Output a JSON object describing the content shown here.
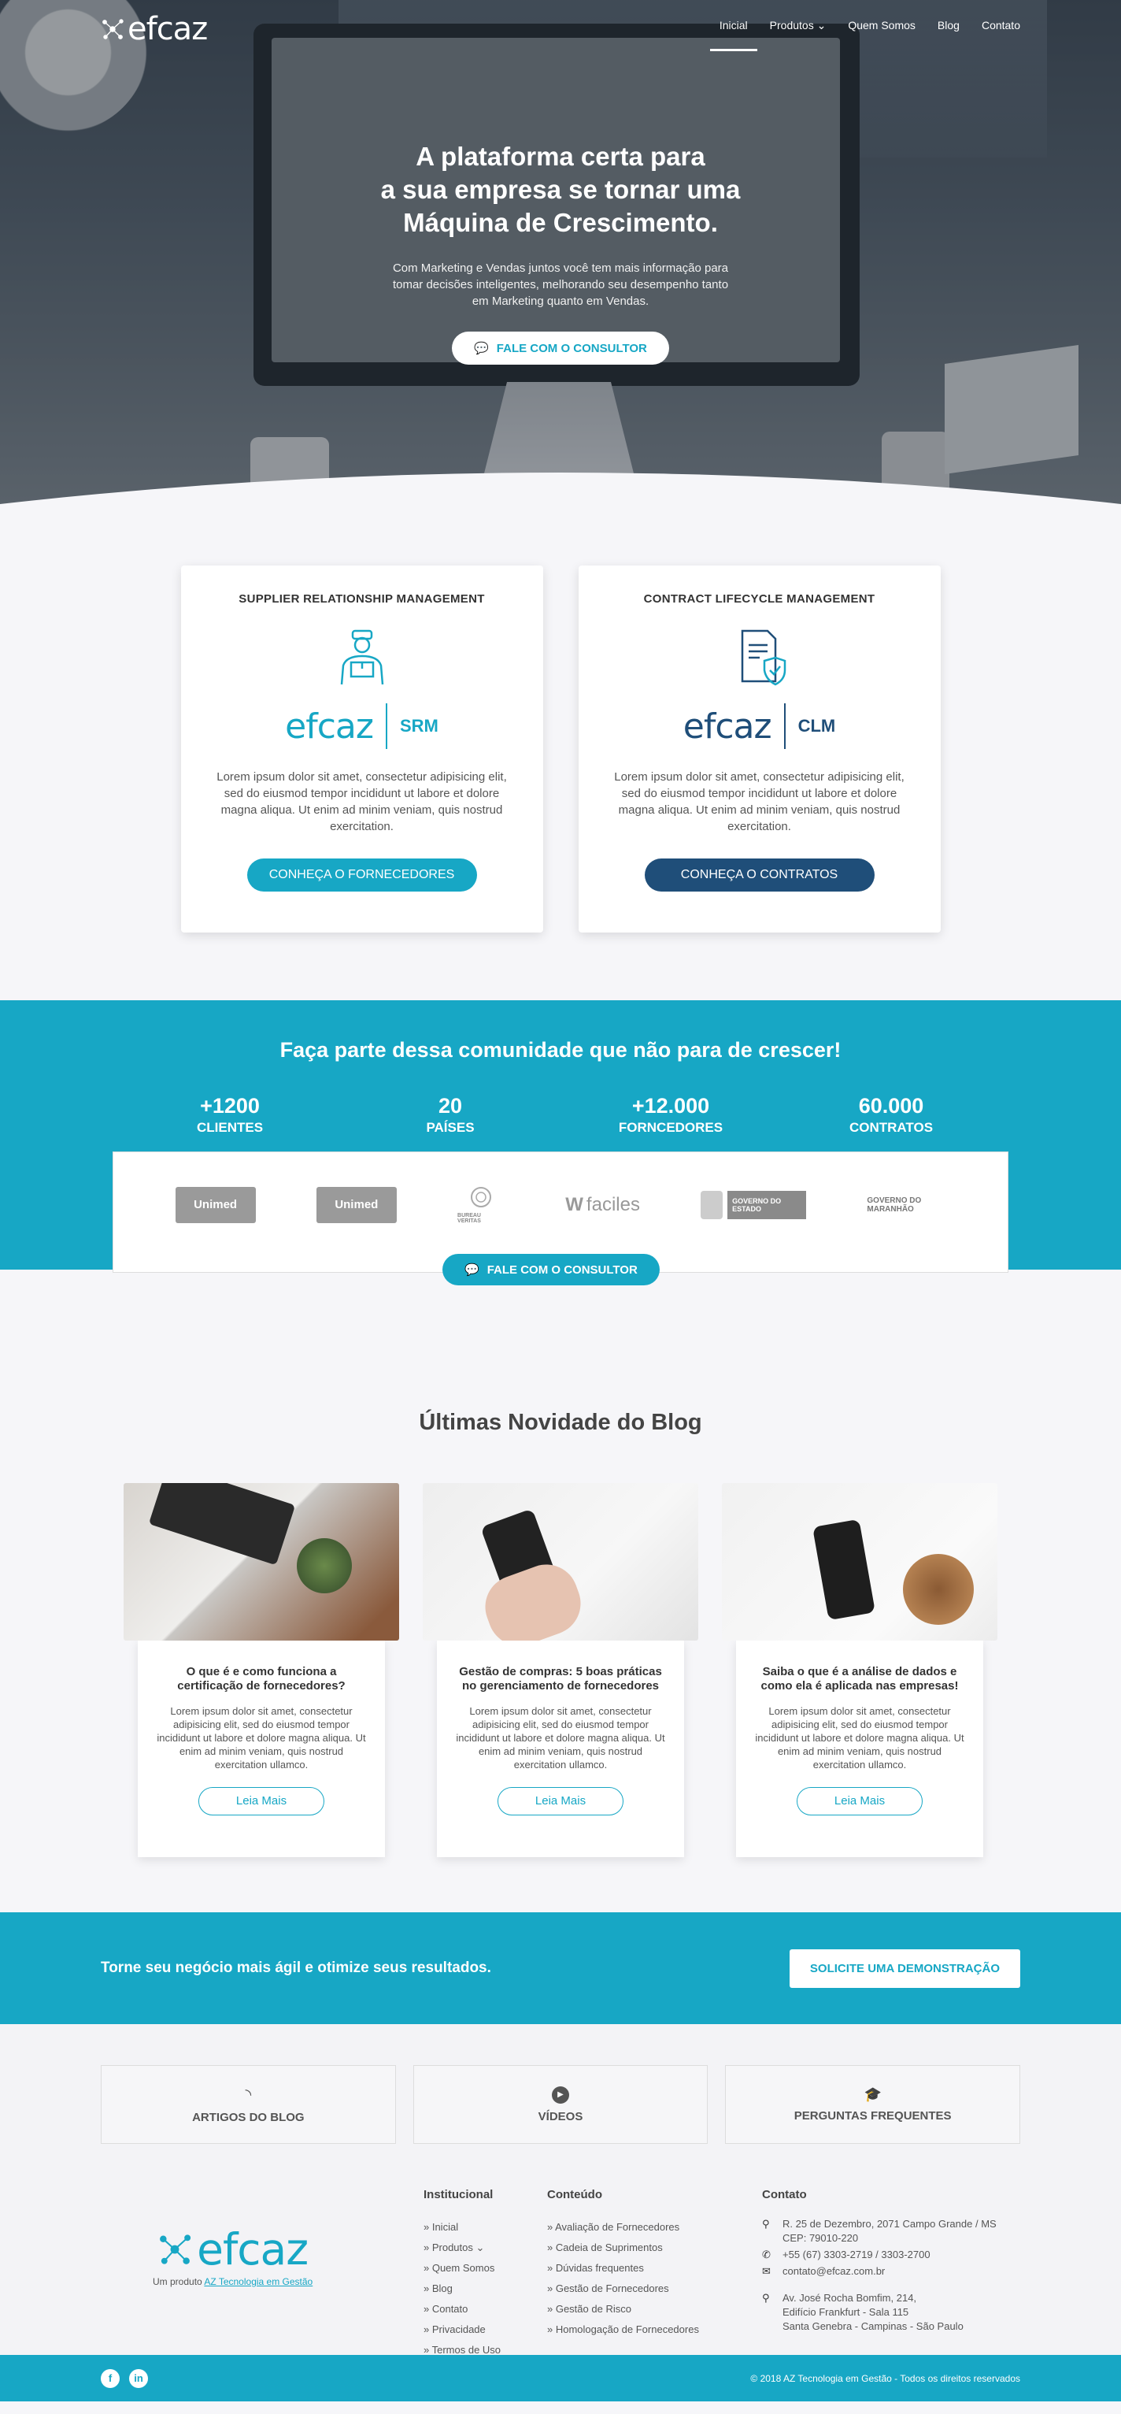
{
  "brand": {
    "name": "efcaz",
    "accent": "#17a7c5",
    "dark_accent": "#1f4e79"
  },
  "nav": {
    "items": [
      "Inicial",
      "Produtos",
      "Quem Somos",
      "Blog",
      "Contato"
    ],
    "active": "Inicial"
  },
  "hero": {
    "title_line1": "A plataforma certa para",
    "title_line2": "a sua empresa se tornar uma",
    "title_line3": "Máquina de Crescimento.",
    "text_line1": "Com Marketing e Vendas juntos você tem mais informação para",
    "text_line2": "tomar decisões inteligentes, melhorando seu desempenho tanto",
    "text_line3": "em Marketing quanto em Vendas.",
    "button": "FALE COM O CONSULTOR"
  },
  "products": [
    {
      "title": "SUPPLIER RELATIONSHIP MANAGEMENT",
      "logo": "efcaz",
      "code": "SRM",
      "text": "Lorem ipsum dolor sit amet, consectetur adipisicing elit, sed do eiusmod tempor incididunt ut labore et dolore magna aliqua. Ut enim ad minim veniam, quis nostrud exercitation.",
      "button": "CONHEÇA O FORNECEDORES",
      "color": "#17a7c5"
    },
    {
      "title": "CONTRACT LIFECYCLE MANAGEMENT",
      "logo": "efcaz",
      "code": "CLM",
      "text": "Lorem ipsum dolor sit amet, consectetur adipisicing elit, sed do eiusmod tempor incididunt ut labore et dolore magna aliqua. Ut enim ad minim veniam, quis nostrud exercitation.",
      "button": "CONHEÇA O CONTRATOS",
      "color": "#1f4e79"
    }
  ],
  "community": {
    "title": "Faça parte dessa comunidade que não para de crescer!",
    "stats": [
      {
        "num": "+1200",
        "label": "CLIENTES"
      },
      {
        "num": "20",
        "label": "PAÍSES"
      },
      {
        "num": "+12.000",
        "label": "FORNCEDORES"
      },
      {
        "num": "60.000",
        "label": "CONTRATOS"
      }
    ],
    "partners": [
      "Unimed",
      "Unimed",
      "BUREAU VERITAS",
      "faciles",
      "GOVERNO DO ESTADO",
      "GOVERNO DO MARANHÃO"
    ],
    "button": "FALE COM O CONSULTOR"
  },
  "blog": {
    "title": "Últimas Novidade do Blog",
    "posts": [
      {
        "title": "O que é e como funciona a certificação de fornecedores?",
        "text": "Lorem ipsum dolor sit amet, consectetur adipisicing elit, sed do eiusmod tempor incididunt ut labore et dolore magna aliqua. Ut enim ad minim veniam, quis nostrud exercitation ullamco.",
        "button": "Leia Mais"
      },
      {
        "title": "Gestão de compras: 5 boas práticas no gerenciamento de fornecedores",
        "text": "Lorem ipsum dolor sit amet, consectetur adipisicing elit, sed do eiusmod tempor incididunt ut labore et dolore magna aliqua. Ut enim ad minim veniam, quis nostrud exercitation ullamco.",
        "button": "Leia Mais"
      },
      {
        "title": "Saiba o que é a análise de dados e como ela é aplicada nas empresas!",
        "text": "Lorem ipsum dolor sit amet, consectetur adipisicing elit, sed do eiusmod tempor incididunt ut labore et dolore magna aliqua. Ut enim ad minim veniam, quis nostrud exercitation ullamco.",
        "button": "Leia Mais"
      }
    ]
  },
  "cta": {
    "text": "Torne seu negócio mais ágil e otimize seus resultados.",
    "button": "SOLICITE UMA DEMONSTRAÇÃO"
  },
  "footer": {
    "resources": [
      "ARTIGOS DO BLOG",
      "VÍDEOS",
      "PERGUNTAS FREQUENTES"
    ],
    "logo_sub": "Um produto",
    "logo_link": "AZ Tecnologia em Gestão",
    "institucional": {
      "title": "Institucional",
      "items": [
        "» Inicial",
        "» Produtos",
        "» Quem Somos",
        "» Blog",
        "» Contato",
        "» Privacidade",
        "» Termos de Uso"
      ]
    },
    "conteudo": {
      "title": "Conteúdo",
      "items": [
        "» Avaliação de Fornecedores",
        "» Cadeia de Suprimentos",
        "» Dúvidas frequentes",
        "» Gestão de Fornecedores",
        "» Gestão de Risco",
        "» Homologação de Fornecedores"
      ]
    },
    "contato": {
      "title": "Contato",
      "address1_l1": "R. 25 de Dezembro, 2071 Campo Grande / MS",
      "address1_l2": "CEP: 79010-220",
      "phone": "+55 (67) 3303-2719 / 3303-2700",
      "email": "contato@efcaz.com.br",
      "address2_l1": "Av. José Rocha Bomfim, 214,",
      "address2_l2": "Edifício Frankfurt - Sala 115",
      "address2_l3": "Santa Genebra - Campinas - São Paulo"
    },
    "copyright": "© 2018 AZ Tecnologia em Gestão - Todos os direitos reservados"
  }
}
